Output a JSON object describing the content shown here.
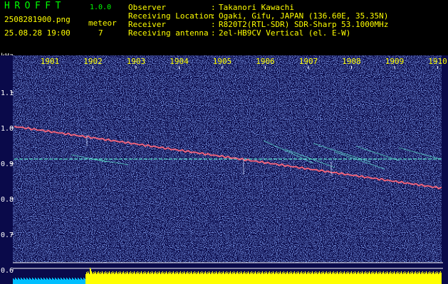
{
  "app": {
    "title": "HROFFT",
    "version": "1.0.0"
  },
  "file_name": "2508281900.png",
  "timestamp": "25.08.28 19:00",
  "detection": {
    "type": "meteor",
    "count": "7"
  },
  "info": [
    {
      "key": "Observer",
      "value": "Takanori Kawachi"
    },
    {
      "key": "Receiving Location",
      "value": "Ogaki, Gifu, JAPAN (136.60E, 35.35N)"
    },
    {
      "key": "Receiver",
      "value": "R820T2(RTL-SDR) SDR-Sharp 53.1000MHz"
    },
    {
      "key": "Receiving antenna",
      "value": "2el-HB9CV Vertical (el. E-W)"
    }
  ],
  "spectrogram": {
    "unit": "kHz",
    "time_ticks": [
      "1901",
      "1902",
      "1903",
      "1904",
      "1905",
      "1906",
      "1907",
      "1908",
      "1909",
      "1910"
    ],
    "freq_ticks": [
      "1.1",
      "1.0",
      "0.9",
      "0.8",
      "0.7",
      "0.6"
    ],
    "colors": {
      "background": "#0a0a4a",
      "noise": "#3a5ad8",
      "trace": "#ff4a4a",
      "reference_line": "#66ffdd",
      "level_high": "#ffff00",
      "level_low": "#00bfff"
    }
  }
}
